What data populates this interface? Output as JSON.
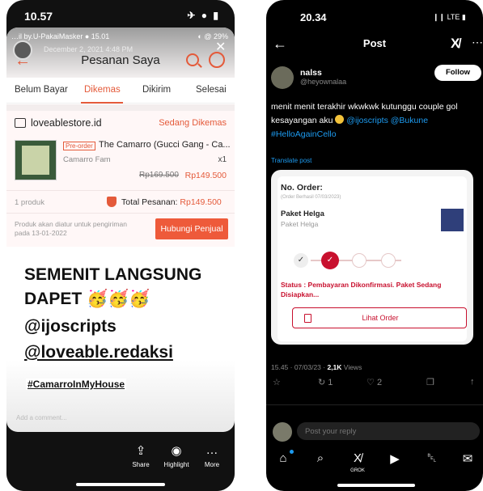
{
  "left": {
    "status": {
      "time": "10.57",
      "icons": "✈ ● ▮"
    },
    "inner_status": {
      "left": "…il by.U-PakaiMasker ●  15.01",
      "right": "◐ @ 29%",
      "date": "December 2, 2021  4:48 PM"
    },
    "shop": {
      "title": "Pesanan Saya",
      "tabs": [
        "Belum Bayar",
        "Dikemas",
        "Dikirim",
        "Selesai"
      ],
      "active_tab": "Dikemas",
      "store_name": "loveablestore.id",
      "store_status": "Sedang Dikemas",
      "preorder_badge": "Pre-order",
      "product_name": "The Camarro (Gucci Gang - Ca...",
      "variant": "Camarro Fam",
      "qty": "x1",
      "price_old": "Rp169.500",
      "price_new": "Rp149.500",
      "count": "1 produk",
      "total_label": "Total Pesanan:",
      "total_value": "Rp149.500",
      "ship_note": "Produk akan diatur untuk pengiriman pada 13-01-2022",
      "contact_button": "Hubungi Penjual"
    },
    "story": {
      "line1": "SEMENIT LANGSUNG",
      "line2": "DAPET 🥳🥳🥳",
      "line3": "@ijoscripts",
      "line4": "@loveable.redaksi",
      "hashtag": "#CamarroInMyHouse",
      "comment_placeholder": "Add a comment..."
    },
    "actions": [
      {
        "icon": "⇪",
        "label": "Share"
      },
      {
        "icon": "◉",
        "label": "Highlight"
      },
      {
        "icon": "…",
        "label": "More"
      }
    ]
  },
  "right": {
    "status": {
      "time": "20.34",
      "signal": "❙❙ LTE ▮"
    },
    "header": {
      "back": "←",
      "title": "Post",
      "grok": "X̸",
      "more": "⋯"
    },
    "author": {
      "name": "nalss",
      "handle": "@heyownalaa",
      "follow": "Follow"
    },
    "tweet": {
      "text_before": "menit menit terakhir wkwkwk kutunggu couple gol kesayangan aku ",
      "mention1": "@ijoscripts",
      "mention2": "@Bukune",
      "hashtag": "#HelloAgainCello"
    },
    "translate": "Translate post",
    "order_card": {
      "order_label": "No. Order:",
      "order_sub": "(Order Berhasil 07/03/2023)",
      "package": "Paket Helga",
      "package_sub": "Paket Helga",
      "status": "Status : Pembayaran Dikonfirmasi. Paket Sedang Disiapkan...",
      "button": "Lihat Order"
    },
    "meta": {
      "time": "15.45 · 07/03/23 · ",
      "views_count": "2,1K",
      "views_label": " Views"
    },
    "actions": [
      {
        "icon": "☆",
        "label": ""
      },
      {
        "icon": "↻",
        "label": "1"
      },
      {
        "icon": "♡",
        "label": "2"
      },
      {
        "icon": "❐",
        "label": ""
      },
      {
        "icon": "↑",
        "label": ""
      }
    ],
    "reply_placeholder": "Post your reply",
    "nav": [
      {
        "icon": "⌂",
        "label": ""
      },
      {
        "icon": "⌕",
        "label": ""
      },
      {
        "icon": "X̸",
        "label": "GROK"
      },
      {
        "icon": "▶",
        "label": ""
      },
      {
        "icon": "␇",
        "label": ""
      },
      {
        "icon": "✉",
        "label": ""
      }
    ]
  }
}
